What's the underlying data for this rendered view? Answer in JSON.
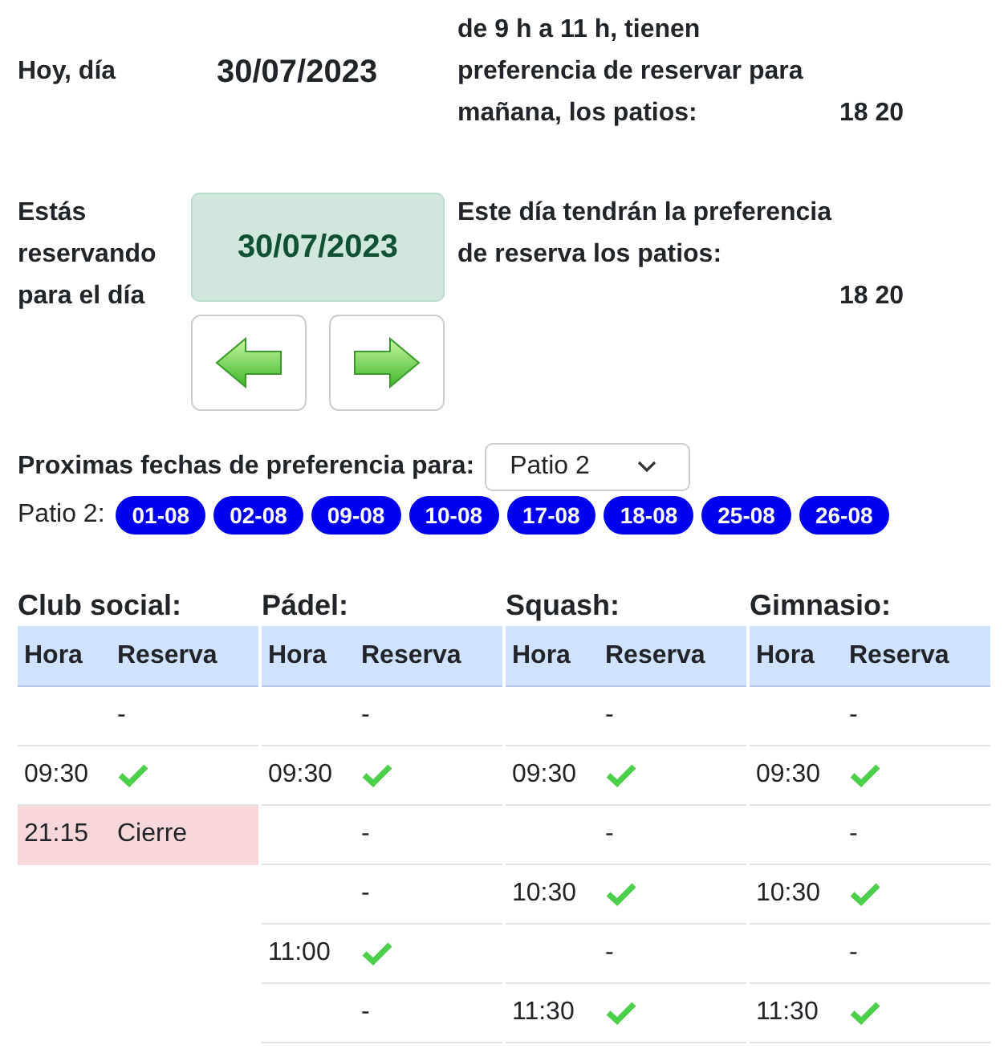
{
  "today": {
    "label": "Hoy, día",
    "date": "30/07/2023",
    "note": "de 9 h a 11 h, tienen preferencia de reservar para mañana, los patios:",
    "courts": "18 20"
  },
  "booking": {
    "label": "Estás reservando para el día",
    "date": "30/07/2023",
    "note": "Este día tendrán la preferencia de reserva los patios:",
    "courts": "18 20"
  },
  "upcoming": {
    "label": "Proximas fechas de preferencia para:",
    "select": "Patio 2",
    "prefix": "Patio 2:",
    "dates": [
      "01-08",
      "02-08",
      "09-08",
      "10-08",
      "17-08",
      "18-08",
      "25-08",
      "26-08"
    ]
  },
  "tables": [
    {
      "title": "Club social:",
      "columns": [
        "Hora",
        "Reserva"
      ],
      "rows": [
        {
          "reserva": "-",
          "kind": "text",
          "highlighted": false
        },
        {
          "hora": "09:30",
          "kind": "check",
          "highlighted": false
        },
        {
          "hora": "21:15",
          "reserva": "Cierre",
          "kind": "text",
          "highlighted": true
        }
      ]
    },
    {
      "title": "Pádel:",
      "columns": [
        "Hora",
        "Reserva"
      ],
      "rows": [
        {
          "reserva": "-",
          "kind": "text",
          "highlighted": false
        },
        {
          "hora": "09:30",
          "kind": "check",
          "highlighted": false
        },
        {
          "reserva": "-",
          "kind": "text",
          "highlighted": false
        },
        {
          "reserva": "-",
          "kind": "text",
          "highlighted": false
        },
        {
          "hora": "11:00",
          "kind": "check",
          "highlighted": false
        },
        {
          "reserva": "-",
          "kind": "text",
          "highlighted": false
        }
      ]
    },
    {
      "title": "Squash:",
      "columns": [
        "Hora",
        "Reserva"
      ],
      "rows": [
        {
          "reserva": "-",
          "kind": "text",
          "highlighted": false
        },
        {
          "hora": "09:30",
          "kind": "check",
          "highlighted": false
        },
        {
          "reserva": "-",
          "kind": "text",
          "highlighted": false
        },
        {
          "hora": "10:30",
          "kind": "check",
          "highlighted": false
        },
        {
          "reserva": "-",
          "kind": "text",
          "highlighted": false
        },
        {
          "hora": "11:30",
          "kind": "check",
          "highlighted": false
        }
      ]
    },
    {
      "title": "Gimnasio:",
      "columns": [
        "Hora",
        "Reserva"
      ],
      "rows": [
        {
          "reserva": "-",
          "kind": "text",
          "highlighted": false
        },
        {
          "hora": "09:30",
          "kind": "check",
          "highlighted": false
        },
        {
          "reserva": "-",
          "kind": "text",
          "highlighted": false
        },
        {
          "hora": "10:30",
          "kind": "check",
          "highlighted": false
        },
        {
          "reserva": "-",
          "kind": "text",
          "highlighted": false
        },
        {
          "hora": "11:30",
          "kind": "check",
          "highlighted": false
        }
      ]
    }
  ]
}
